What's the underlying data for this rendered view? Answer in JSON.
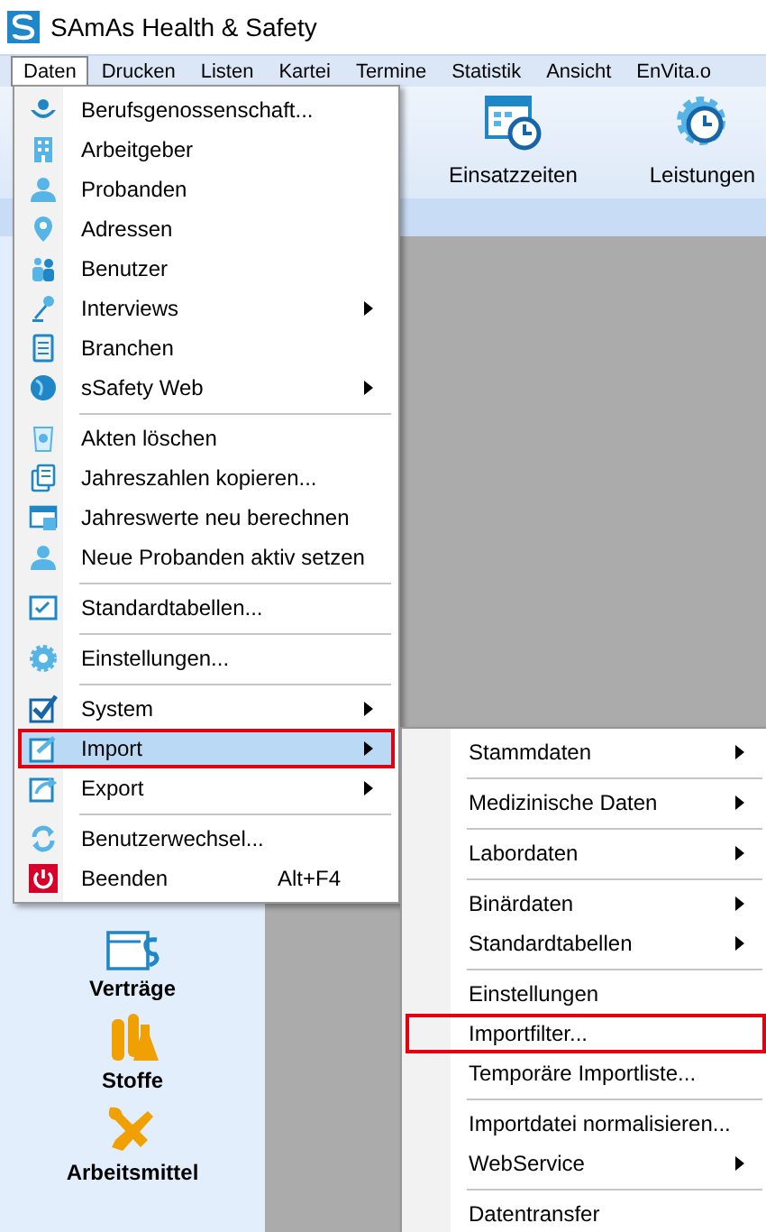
{
  "window": {
    "title": "SAmAs Health & Safety"
  },
  "menubar": [
    {
      "label": "Daten",
      "selected": true
    },
    {
      "label": "Drucken",
      "selected": false
    },
    {
      "label": "Listen",
      "selected": false
    },
    {
      "label": "Kartei",
      "selected": false
    },
    {
      "label": "Termine",
      "selected": false
    },
    {
      "label": "Statistik",
      "selected": false
    },
    {
      "label": "Ansicht",
      "selected": false
    },
    {
      "label": "EnVita.o",
      "selected": false
    }
  ],
  "toolbar": [
    {
      "label": "Einsatzzeiten"
    },
    {
      "label": "Leistungen"
    }
  ],
  "nav": [
    {
      "label": "Verträge"
    },
    {
      "label": "Stoffe"
    },
    {
      "label": "Arbeitsmittel"
    }
  ],
  "menu": {
    "items": [
      {
        "kind": "item",
        "label": "Berufsgenossenschaft...",
        "submenu": false,
        "selected": false,
        "highlighted": false
      },
      {
        "kind": "item",
        "label": "Arbeitgeber",
        "submenu": false,
        "selected": false,
        "highlighted": false
      },
      {
        "kind": "item",
        "label": "Probanden",
        "submenu": false,
        "selected": false,
        "highlighted": false
      },
      {
        "kind": "item",
        "label": "Adressen",
        "submenu": false,
        "selected": false,
        "highlighted": false
      },
      {
        "kind": "item",
        "label": "Benutzer",
        "submenu": false,
        "selected": false,
        "highlighted": false
      },
      {
        "kind": "item",
        "label": "Interviews",
        "submenu": true,
        "selected": false,
        "highlighted": false
      },
      {
        "kind": "item",
        "label": "Branchen",
        "submenu": false,
        "selected": false,
        "highlighted": false
      },
      {
        "kind": "item",
        "label": "sSafety Web",
        "submenu": true,
        "selected": false,
        "highlighted": false
      },
      {
        "kind": "separator"
      },
      {
        "kind": "item",
        "label": "Akten löschen",
        "submenu": false,
        "selected": false,
        "highlighted": false
      },
      {
        "kind": "item",
        "label": "Jahreszahlen kopieren...",
        "submenu": false,
        "selected": false,
        "highlighted": false
      },
      {
        "kind": "item",
        "label": "Jahreswerte neu berechnen",
        "submenu": false,
        "selected": false,
        "highlighted": false
      },
      {
        "kind": "item",
        "label": "Neue Probanden aktiv setzen",
        "submenu": false,
        "selected": false,
        "highlighted": false
      },
      {
        "kind": "separator"
      },
      {
        "kind": "item",
        "label": "Standardtabellen...",
        "submenu": false,
        "selected": false,
        "highlighted": false
      },
      {
        "kind": "separator"
      },
      {
        "kind": "item",
        "label": "Einstellungen...",
        "submenu": false,
        "selected": false,
        "highlighted": false
      },
      {
        "kind": "separator"
      },
      {
        "kind": "item",
        "label": "System",
        "submenu": true,
        "selected": false,
        "highlighted": false
      },
      {
        "kind": "item",
        "label": "Import",
        "submenu": true,
        "selected": true,
        "highlighted": true
      },
      {
        "kind": "item",
        "label": "Export",
        "submenu": true,
        "selected": false,
        "highlighted": false
      },
      {
        "kind": "separator"
      },
      {
        "kind": "item",
        "label": "Benutzerwechsel...",
        "submenu": false,
        "selected": false,
        "highlighted": false
      },
      {
        "kind": "item",
        "label": "Beenden",
        "shortcut": "Alt+F4",
        "submenu": false,
        "selected": false,
        "highlighted": false
      }
    ]
  },
  "submenu": {
    "items": [
      {
        "kind": "item",
        "label": "Stammdaten",
        "submenu": true,
        "selected": false,
        "highlighted": false
      },
      {
        "kind": "separator"
      },
      {
        "kind": "item",
        "label": "Medizinische Daten",
        "submenu": true,
        "selected": false,
        "highlighted": false
      },
      {
        "kind": "separator"
      },
      {
        "kind": "item",
        "label": "Labordaten",
        "submenu": true,
        "selected": false,
        "highlighted": false
      },
      {
        "kind": "separator"
      },
      {
        "kind": "item",
        "label": "Binärdaten",
        "submenu": true,
        "selected": false,
        "highlighted": false
      },
      {
        "kind": "item",
        "label": "Standardtabellen",
        "submenu": true,
        "selected": false,
        "highlighted": false
      },
      {
        "kind": "separator"
      },
      {
        "kind": "item",
        "label": "Einstellungen",
        "submenu": false,
        "selected": false,
        "highlighted": false
      },
      {
        "kind": "item",
        "label": "Importfilter...",
        "submenu": false,
        "selected": false,
        "highlighted": true
      },
      {
        "kind": "item",
        "label": "Temporäre Importliste...",
        "submenu": false,
        "selected": false,
        "highlighted": false
      },
      {
        "kind": "separator"
      },
      {
        "kind": "item",
        "label": "Importdatei normalisieren...",
        "submenu": false,
        "selected": false,
        "highlighted": false
      },
      {
        "kind": "item",
        "label": "WebService",
        "submenu": true,
        "selected": false,
        "highlighted": false
      },
      {
        "kind": "separator"
      },
      {
        "kind": "item",
        "label": "Datentransfer",
        "submenu": false,
        "selected": false,
        "highlighted": false
      }
    ]
  }
}
